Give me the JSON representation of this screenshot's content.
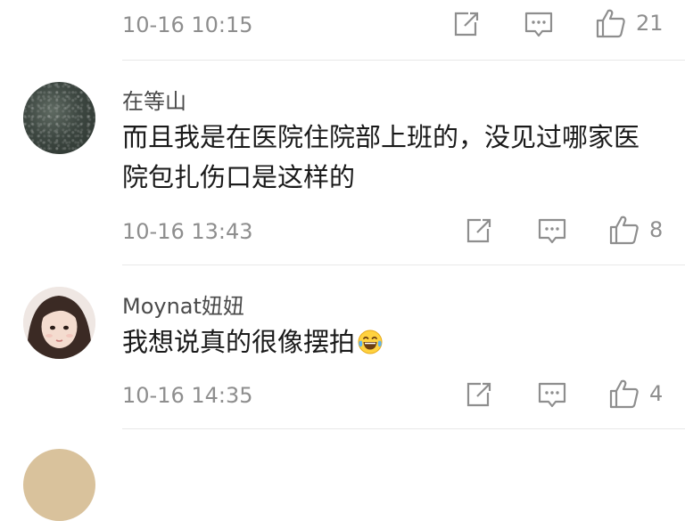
{
  "comments": [
    {
      "username": "",
      "text": "",
      "time": "10-16 10:15",
      "likes": "21"
    },
    {
      "username": "在等山",
      "text": "而且我是在医院住院部上班的，没见过哪家医院包扎伤口是这样的",
      "time": "10-16 13:43",
      "likes": "8"
    },
    {
      "username": "Moynat妞妞",
      "text": "我想说真的很像摆拍",
      "time": "10-16 14:35",
      "likes": "4"
    }
  ],
  "icons": {
    "share": "share-icon",
    "reply": "comment-icon",
    "like": "thumbs-up-icon",
    "emoji": "laughing-tears-emoji-icon"
  },
  "colors": {
    "meta_gray": "#8e8e8e",
    "icon_gray": "#8e8e8e",
    "divider": "#e8e8e8",
    "text": "#1a1a1a"
  }
}
